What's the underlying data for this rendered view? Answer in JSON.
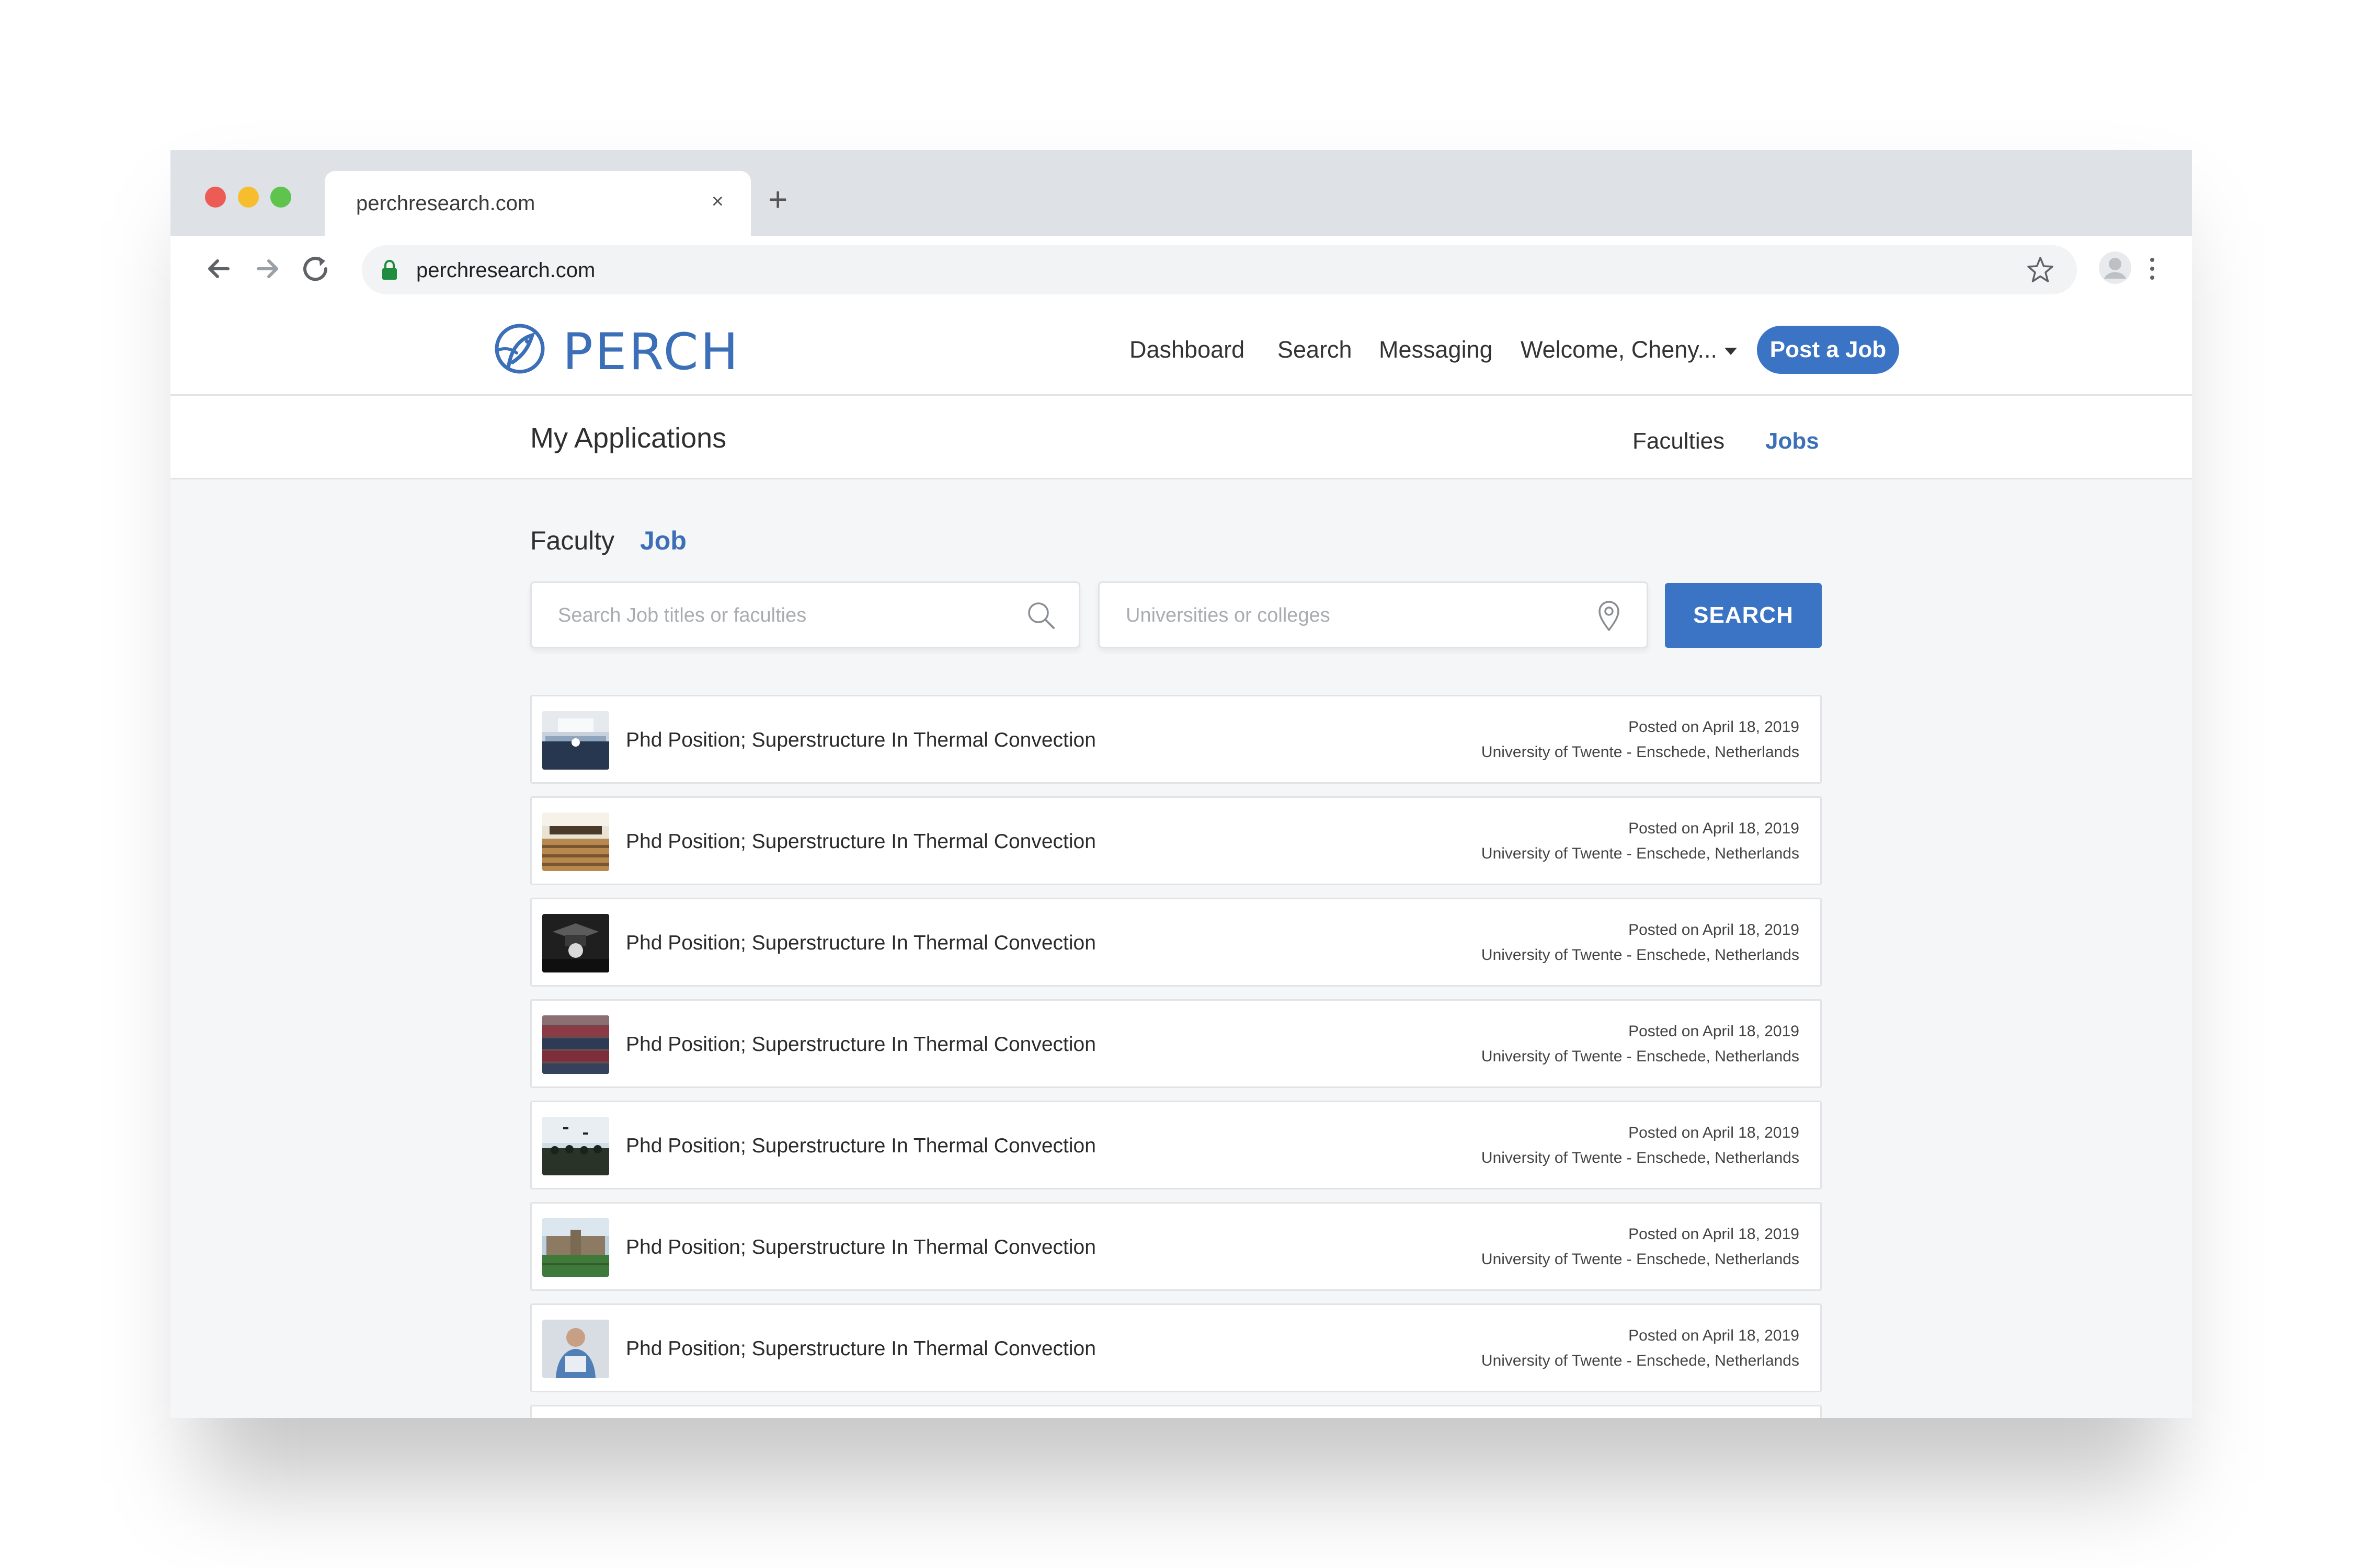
{
  "browser": {
    "tab_title": "perchresearch.com",
    "tab_close": "×",
    "new_tab": "+",
    "url": "perchresearch.com"
  },
  "header": {
    "logo_text": "PERCH",
    "nav": {
      "dashboard": "Dashboard",
      "search": "Search",
      "messaging": "Messaging",
      "welcome": "Welcome, Cheny..."
    },
    "post_job": "Post a Job"
  },
  "subheader": {
    "title": "My Applications",
    "faculties": "Faculties",
    "jobs": "Jobs",
    "active": "Jobs"
  },
  "filter": {
    "tabs": [
      "Faculty",
      "Job"
    ],
    "active": "Job",
    "search_placeholder": "Search Job titles or faculties",
    "location_placeholder": "Universities or colleges",
    "search_button": "SEARCH"
  },
  "colors": {
    "accent": "#3b74c4",
    "brand": "#3b6fb7",
    "background": "#f5f6f8"
  },
  "listings": [
    {
      "title": "Phd Position; Superstructure In Thermal Convection",
      "posted": "Posted on April 18, 2019",
      "location": "University of Twente - Enschede, Netherlands",
      "thumb": "lecture-hall-photo"
    },
    {
      "title": "Phd Position; Superstructure In Thermal Convection",
      "posted": "Posted on April 18, 2019",
      "location": "University of Twente - Enschede, Netherlands",
      "thumb": "auditorium-photo"
    },
    {
      "title": "Phd Position; Superstructure In Thermal Convection",
      "posted": "Posted on April 18, 2019",
      "location": "University of Twente - Enschede, Netherlands",
      "thumb": "graduation-cap-photo"
    },
    {
      "title": "Phd Position; Superstructure In Thermal Convection",
      "posted": "Posted on April 18, 2019",
      "location": "University of Twente - Enschede, Netherlands",
      "thumb": "graduates-crowd-photo"
    },
    {
      "title": "Phd Position; Superstructure In Thermal Convection",
      "posted": "Posted on April 18, 2019",
      "location": "University of Twente - Enschede, Netherlands",
      "thumb": "caps-in-air-photo"
    },
    {
      "title": "Phd Position; Superstructure In Thermal Convection",
      "posted": "Posted on April 18, 2019",
      "location": "University of Twente - Enschede, Netherlands",
      "thumb": "campus-building-photo"
    },
    {
      "title": "Phd Position; Superstructure In Thermal Convection",
      "posted": "Posted on April 18, 2019",
      "location": "University of Twente - Enschede, Netherlands",
      "thumb": "student-portrait-photo"
    }
  ]
}
